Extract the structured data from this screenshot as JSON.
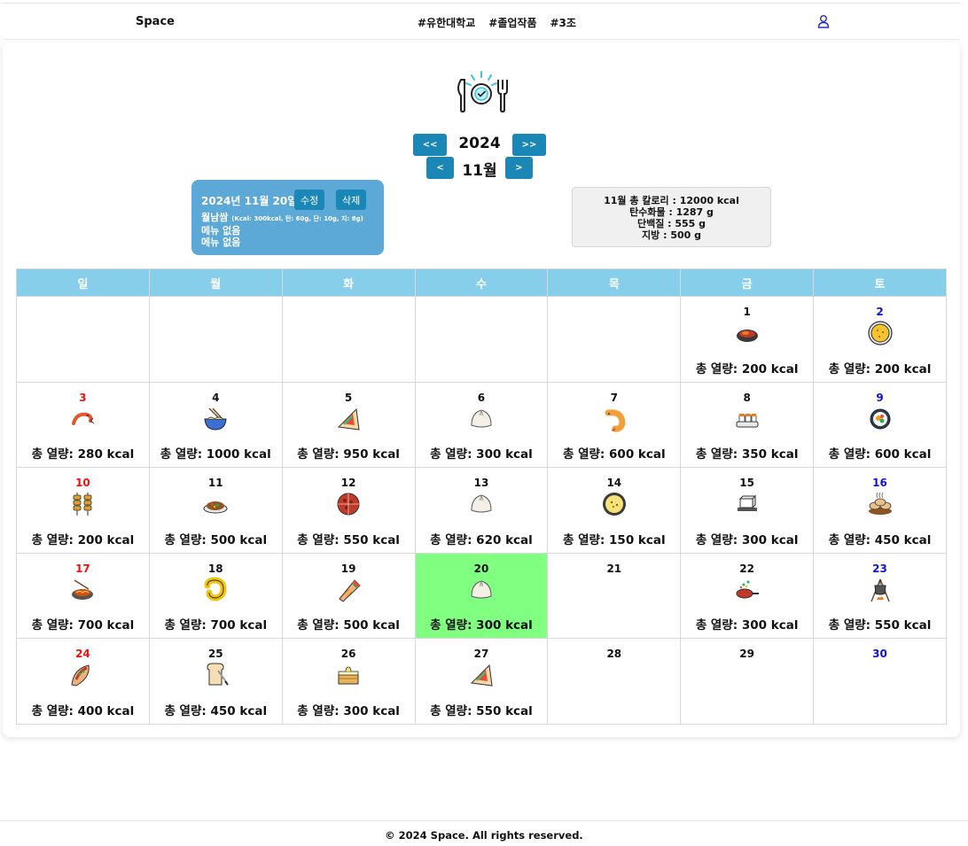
{
  "header": {
    "brand": "Space",
    "tags": [
      "#유한대학교",
      "#졸업작품",
      "#3조"
    ],
    "user_icon": "user-icon"
  },
  "logo_icon": "plate-fork-knife-check-icon",
  "nav": {
    "year_prev": "<<",
    "year_next": ">>",
    "month_prev": "<",
    "month_next": ">",
    "year": "2024",
    "month": "11월"
  },
  "detail": {
    "date": "2024년 11월 20일",
    "edit_label": "수정",
    "delete_label": "삭제",
    "menu_name": "월남쌈",
    "menu_nutrition": "(Kcal: 300kcal, 탄: 60g, 단: 10g, 지: 8g)",
    "line2": "메뉴 없음",
    "line3": "메뉴 없음"
  },
  "summary": {
    "calories": "11월 총 칼로리 : 12000 kcal",
    "carbs": "탄수화물 : 1287 g",
    "protein": "단백질 : 555 g",
    "fat": "지방 : 500 g"
  },
  "weekdays": [
    "일",
    "월",
    "화",
    "수",
    "목",
    "금",
    "토"
  ],
  "colors": {
    "header_bg": "#87ceeb",
    "button": "#1b87b7",
    "detail_bg": "#5ca8d6",
    "today_bg": "#80ff80",
    "sunday": "#ee1111",
    "saturday": "#1111dd"
  },
  "weeks": [
    [
      {
        "day": "",
        "kcal": "",
        "icon": ""
      },
      {
        "day": "",
        "kcal": "",
        "icon": ""
      },
      {
        "day": "",
        "kcal": "",
        "icon": ""
      },
      {
        "day": "",
        "kcal": "",
        "icon": ""
      },
      {
        "day": "",
        "kcal": "",
        "icon": ""
      },
      {
        "day": "1",
        "kcal": "총 열량: 200 kcal",
        "icon": "stew-bowl-icon"
      },
      {
        "day": "2",
        "kcal": "총 열량: 200 kcal",
        "icon": "pancake-plate-icon"
      }
    ],
    [
      {
        "day": "3",
        "kcal": "총 열량: 280 kcal",
        "icon": "shrimp-icon"
      },
      {
        "day": "4",
        "kcal": "총 열량: 1000 kcal",
        "icon": "noodle-bowl-icon"
      },
      {
        "day": "5",
        "kcal": "총 열량: 950 kcal",
        "icon": "sandwich-wrap-icon"
      },
      {
        "day": "6",
        "kcal": "총 열량: 300 kcal",
        "icon": "dumpling-icon"
      },
      {
        "day": "7",
        "kcal": "총 열량: 600 kcal",
        "icon": "fried-shrimp-icon"
      },
      {
        "day": "8",
        "kcal": "총 열량: 350 kcal",
        "icon": "sushi-plate-icon"
      },
      {
        "day": "9",
        "kcal": "총 열량: 600 kcal",
        "icon": "sushi-roll-icon"
      }
    ],
    [
      {
        "day": "10",
        "kcal": "총 열량: 200 kcal",
        "icon": "skewers-icon"
      },
      {
        "day": "11",
        "kcal": "총 열량: 500 kcal",
        "icon": "rice-dish-icon"
      },
      {
        "day": "12",
        "kcal": "총 열량: 550 kcal",
        "icon": "pizza-icon"
      },
      {
        "day": "13",
        "kcal": "총 열량: 620 kcal",
        "icon": "dumpling-icon"
      },
      {
        "day": "14",
        "kcal": "총 열량: 150 kcal",
        "icon": "soup-bowl-icon"
      },
      {
        "day": "15",
        "kcal": "총 열량: 300 kcal",
        "icon": "tofu-icon"
      },
      {
        "day": "16",
        "kcal": "총 열량: 450 kcal",
        "icon": "steamed-buns-icon"
      }
    ],
    [
      {
        "day": "17",
        "kcal": "총 열량: 700 kcal",
        "icon": "noodle-plate-icon"
      },
      {
        "day": "18",
        "kcal": "총 열량: 700 kcal",
        "icon": "macaroni-icon"
      },
      {
        "day": "19",
        "kcal": "총 열량: 500 kcal",
        "icon": "burrito-icon"
      },
      {
        "day": "20",
        "kcal": "총 열량: 300 kcal",
        "icon": "dumpling-icon"
      },
      {
        "day": "21",
        "kcal": "",
        "icon": ""
      },
      {
        "day": "22",
        "kcal": "총 열량: 300 kcal",
        "icon": "frying-pan-icon"
      },
      {
        "day": "23",
        "kcal": "총 열량: 550 kcal",
        "icon": "campfire-pot-icon"
      }
    ],
    [
      {
        "day": "24",
        "kcal": "총 열량: 400 kcal",
        "icon": "taco-icon"
      },
      {
        "day": "25",
        "kcal": "총 열량: 450 kcal",
        "icon": "toast-icon"
      },
      {
        "day": "26",
        "kcal": "총 열량: 300 kcal",
        "icon": "cake-icon"
      },
      {
        "day": "27",
        "kcal": "총 열량: 550 kcal",
        "icon": "sandwich-wrap-icon"
      },
      {
        "day": "28",
        "kcal": "",
        "icon": ""
      },
      {
        "day": "29",
        "kcal": "",
        "icon": ""
      },
      {
        "day": "30",
        "kcal": "",
        "icon": ""
      }
    ]
  ],
  "today": "20",
  "footer": "© 2024 Space. All rights reserved."
}
